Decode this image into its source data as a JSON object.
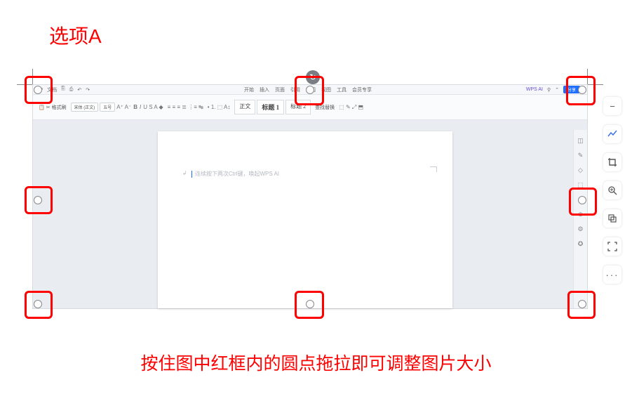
{
  "title_label": "选项A",
  "caption": "按住图中红框内的圆点拖拉即可调整图片大小",
  "wps": {
    "doc_tab": "文档",
    "wps_ai": "WPS AI",
    "share": "分享",
    "menus": [
      "开始",
      "插入",
      "页面",
      "引用",
      "审阅",
      "视图",
      "工具",
      "会员专享"
    ],
    "active_menu": "开始",
    "format_brush": "格式刷",
    "font_name": "宋体 (正文)",
    "font_size": "五号",
    "style_normal": "正文",
    "style_h1": "标题 1",
    "style_h2": "标题 2",
    "find": "查找替换",
    "cursor_hint": "连续按下两次Ctrl键，唤起WPS AI"
  },
  "side_tools": {
    "minus": "−",
    "chart": "line-chart-icon",
    "crop": "crop-icon",
    "zoom": "zoom-in-icon",
    "copy": "copy-icon",
    "fullscreen": "fullscreen-icon",
    "more": "···"
  }
}
